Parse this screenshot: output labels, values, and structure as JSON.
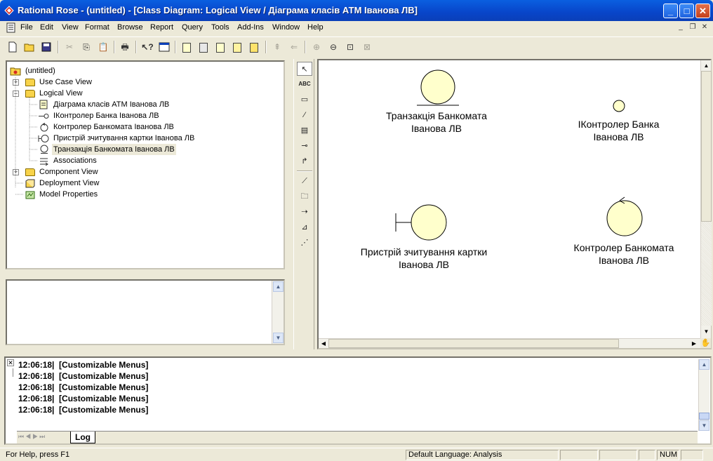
{
  "window": {
    "title": "Rational Rose - (untitled) - [Class Diagram: Logical View / Діаграма класів АТМ Іванова ЛВ]",
    "minimize": "_",
    "maximize": "□",
    "close": "✕"
  },
  "menu": [
    "File",
    "Edit",
    "View",
    "Format",
    "Browse",
    "Report",
    "Query",
    "Tools",
    "Add-Ins",
    "Window",
    "Help"
  ],
  "tree": {
    "root": "(untitled)",
    "use_case_view": "Use Case View",
    "logical_view": "Logical View",
    "class_diagram": "Діаграма класів АТМ Іванова ЛВ",
    "interface": "ІКонтролер Банка Іванова ЛВ",
    "controller": "Контролер Банкомата Іванова ЛВ",
    "boundary": "Пристрій зчитування картки Іванова ЛВ",
    "entity": "Транзакція Банкомата Іванова ЛВ",
    "associations": "Associations",
    "component_view": "Component View",
    "deployment_view": "Deployment View",
    "model_properties": "Model Properties"
  },
  "diagram": {
    "entity_line1": "Транзакція Банкомата",
    "entity_line2": "Іванова ЛВ",
    "interface_line1": "ІКонтролер Банка",
    "interface_line2": "Іванова ЛВ",
    "boundary_line1": "Пристрій зчитування картки",
    "boundary_line2": "Іванова ЛВ",
    "control_line1": "Контролер Банкомата",
    "control_line2": "Іванова ЛВ",
    "fill_color": "#ffffcc"
  },
  "toolbox": {
    "text_tool": "ABC"
  },
  "log": {
    "lines": [
      "12:06:18|  [Customizable Menus]",
      "12:06:18|  [Customizable Menus]",
      "12:06:18|  [Customizable Menus]",
      "12:06:18|  [Customizable Menus]",
      "12:06:18|  [Customizable Menus]"
    ],
    "tab": "Log"
  },
  "status": {
    "help": "For Help, press F1",
    "language": "Default Language: Analysis",
    "num": "NUM"
  }
}
